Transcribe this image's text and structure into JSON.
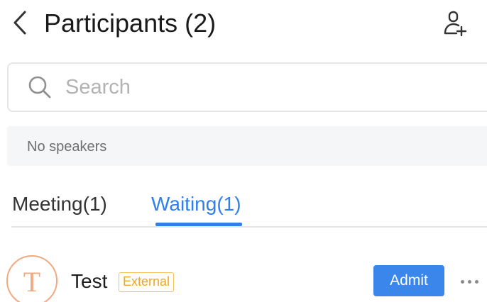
{
  "header": {
    "title": "Participants (2)",
    "back_icon": "chevron-left-icon",
    "add_icon": "add-user-icon"
  },
  "search": {
    "placeholder": "Search",
    "value": "",
    "icon": "search-icon"
  },
  "speakers": {
    "text": "No speakers"
  },
  "tabs": [
    {
      "label": "Meeting(1)",
      "active": false
    },
    {
      "label": "Waiting(1)",
      "active": true
    }
  ],
  "participants": [
    {
      "avatar_letter": "T",
      "name": "Test",
      "badge": "External",
      "action_label": "Admit",
      "more_icon": "more-horizontal-icon"
    }
  ],
  "colors": {
    "accent": "#2f80ed",
    "admit_button": "#3a86ea",
    "badge_border": "#f4c55a",
    "badge_text": "#e9a82c",
    "avatar": "#f2a982"
  }
}
